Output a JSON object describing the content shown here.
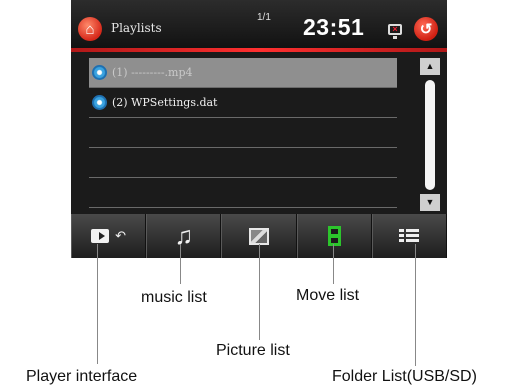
{
  "header": {
    "title": "Playlists",
    "page": "1/1",
    "clock": "23:51"
  },
  "list": {
    "items": [
      {
        "label": "(1) ---------.mp4",
        "selected": true
      },
      {
        "label": "(2) WPSettings.dat",
        "selected": false
      },
      {
        "label": "",
        "selected": false
      },
      {
        "label": "",
        "selected": false
      },
      {
        "label": "",
        "selected": false
      }
    ]
  },
  "toolbar": {
    "items": [
      {
        "icon": "player-interface-icon"
      },
      {
        "icon": "music-note-icon"
      },
      {
        "icon": "picture-icon"
      },
      {
        "icon": "movie-icon"
      },
      {
        "icon": "folder-list-icon"
      }
    ]
  },
  "callouts": {
    "player_interface": "Player interface",
    "music_list": "music list",
    "picture_list": "Picture list",
    "move_list": "Move list",
    "folder_list": "Folder List(USB/SD)"
  },
  "colors": {
    "accent": "#e23a2a",
    "movie_active": "#2cc52c"
  }
}
